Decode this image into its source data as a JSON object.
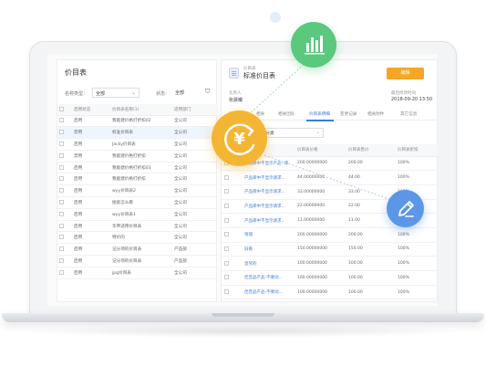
{
  "colors": {
    "accent": "#3b7ddd",
    "edit_button": "#f6a623",
    "chart_badge": "#5ac87d",
    "price_badge": "#f5b534",
    "edit_badge": "#5b97e6"
  },
  "left_panel": {
    "title": "价目表",
    "filter": {
      "type_label": "名称类型：",
      "type_value": "全部",
      "status_label": "状态：",
      "status_value": "全部"
    },
    "columns": [
      "",
      "启用状态",
      "价目表名称(1)",
      "适用部门"
    ],
    "rows": [
      {
        "status": "启用",
        "name": "我能建价格打折扣02",
        "dept": "全公司"
      },
      {
        "status": "禁用",
        "name": "标准价目表",
        "dept": "全公司"
      },
      {
        "status": "启用",
        "name": "Jacky价目表",
        "dept": "全公司"
      },
      {
        "status": "禁用",
        "name": "我能建价格打折扣",
        "dept": "全公司"
      },
      {
        "status": "启用",
        "name": "我能建价格打折扣03",
        "dept": "全公司"
      },
      {
        "status": "启用",
        "name": "我能建价格打折扣",
        "dept": "全公司"
      },
      {
        "status": "启用",
        "name": "wyy价目表2",
        "dept": "全公司"
      },
      {
        "status": "启用",
        "name": "搜索怎么看",
        "dept": "全公司"
      },
      {
        "status": "启用",
        "name": "wyy价目表1",
        "dept": "全公司"
      },
      {
        "status": "启用",
        "name": "华帝适用价目表",
        "dept": "全公司"
      },
      {
        "status": "启用",
        "name": "特价的",
        "dept": "全公司"
      },
      {
        "status": "启用",
        "name": "记分项的价目表",
        "dept": "产品部"
      },
      {
        "status": "启用",
        "name": "记分项的价目表",
        "dept": "产品部"
      },
      {
        "status": "启用",
        "name": "jpg价目表",
        "dept": "全公司"
      }
    ]
  },
  "right_panel": {
    "breadcrumb": "价目表",
    "title": "标准价目表",
    "edit_label": "编辑",
    "owner_label": "负责人",
    "owner_value": "张晨曦",
    "created_label": "最后修改时间",
    "created_value": "2018-09-20 13:50",
    "tabs": [
      "详细信息",
      "相关",
      "相关团队",
      "价目表明细",
      "变更记录",
      "相关附件",
      "其它信息"
    ],
    "active_tab_index": 3,
    "filter_value": "全部明细分类",
    "columns": [
      "",
      "产品名称",
      "价目表价格",
      "价目表售价",
      "价目表折扣"
    ],
    "rows": [
      {
        "name": "产品库中不显示产品--库",
        "list_price": "200.00000000",
        "sale_price": "200.00",
        "discount": "100%"
      },
      {
        "name": "产品库中不显示请求...",
        "list_price": "44.00000000",
        "sale_price": "44.00",
        "discount": "100%"
      },
      {
        "name": "产品库中不显示请求...",
        "list_price": "33.00000000",
        "sale_price": "33.00",
        "discount": "100%"
      },
      {
        "name": "产品库中不显示请求...",
        "list_price": "22.00000000",
        "sale_price": "22.00",
        "discount": "100%"
      },
      {
        "name": "产品库中不显示请求...",
        "list_price": "11.00000000",
        "sale_price": "11.00",
        "discount": "100%"
      },
      {
        "name": "钱瑞",
        "list_price": "200.00000000",
        "sale_price": "200.00",
        "discount": "100%"
      },
      {
        "name": "旧看",
        "list_price": "150.00000000",
        "sale_price": "150.00",
        "discount": "100%"
      },
      {
        "name": "直奖的",
        "list_price": "100.00000000",
        "sale_price": "100.00",
        "discount": "100%"
      },
      {
        "name": "佳音品产品-不要动...",
        "list_price": "100.00000000",
        "sale_price": "100.00",
        "discount": "100%"
      },
      {
        "name": "佳音品产品-不要动...",
        "list_price": "100.00000000",
        "sale_price": "100.00",
        "discount": "100%"
      }
    ]
  },
  "badges": {
    "chart": "bar-chart-icon",
    "price": "yen-refresh-icon",
    "edit": "pencil-icon",
    "price_symbol": "¥"
  }
}
